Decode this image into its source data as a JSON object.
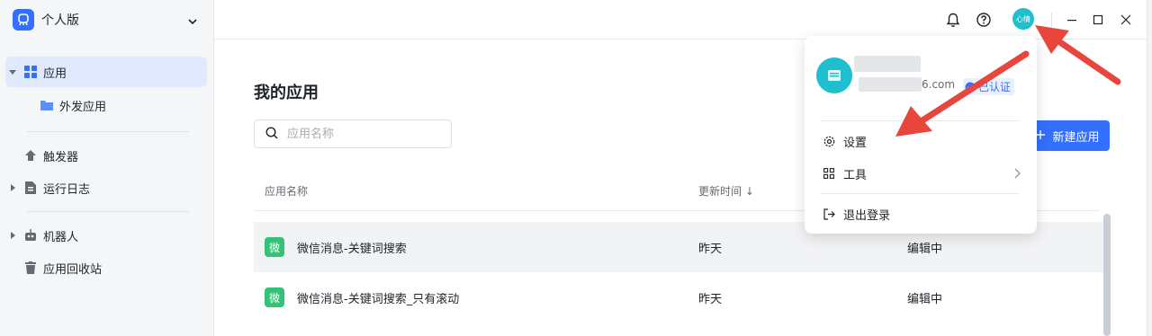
{
  "sidebar": {
    "workspace": "个人版",
    "items": [
      {
        "label": "应用"
      },
      {
        "label": "外发应用"
      },
      {
        "label": "触发器"
      },
      {
        "label": "运行日志"
      },
      {
        "label": "机器人"
      },
      {
        "label": "应用回收站"
      }
    ]
  },
  "topbar": {
    "avatar_text": "心情"
  },
  "main": {
    "title": "我的应用",
    "search_placeholder": "应用名称",
    "new_button": "新建应用",
    "columns": [
      "应用名称",
      "更新时间 ↓"
    ],
    "rows": [
      {
        "badge": "微",
        "name": "微信消息-关键词搜索",
        "updated": "昨天",
        "status": "编辑中"
      },
      {
        "badge": "微",
        "name": "微信消息-关键词搜索_只有滚动",
        "updated": "昨天",
        "status": "编辑中"
      }
    ]
  },
  "menu": {
    "email_tail": "6.com",
    "verified": "已认证",
    "items": [
      {
        "label": "设置"
      },
      {
        "label": "工具"
      },
      {
        "label": "退出登录"
      }
    ]
  },
  "colors": {
    "accent": "#3370ff",
    "avatar": "#1fbfcf",
    "app_badge": "#34c276",
    "annotation": "#e8453c"
  }
}
